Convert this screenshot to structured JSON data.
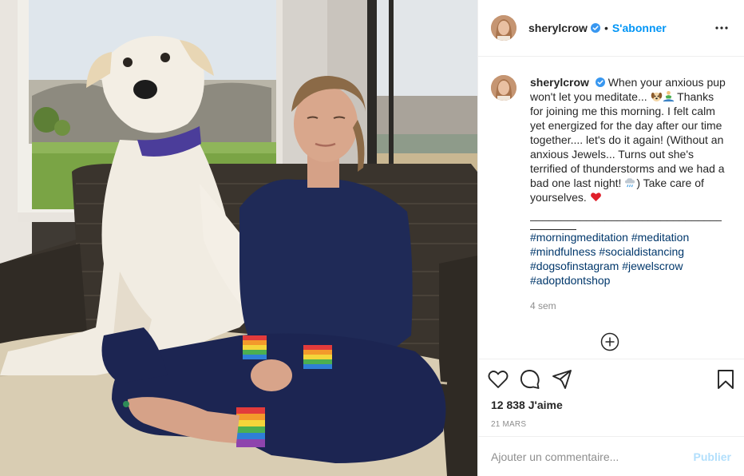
{
  "post": {
    "username": "sherylcrow",
    "follow_label": "S'abonner",
    "dot": "•",
    "verified": true,
    "more_icon": "more-horizontal-icon"
  },
  "caption": {
    "username": "sherylcrow",
    "text_1": "When your anxious pup won't let you meditate... ",
    "text_2": " Thanks for joining me this morning. I felt calm yet energized for the day after our time together.... let's do it again! (Without an anxious Jewels... Turns out she's terrified of thunderstorms and we had a bad one last night! ",
    "text_3": ") Take care of yourselves. ",
    "separator": "_____________________________________________",
    "hashtags": [
      "#morningmeditation",
      "#meditation",
      "#mindfulness",
      "#socialdistancing",
      "#dogsofinstagram",
      "#jewelscrow",
      "#adoptdontshop"
    ],
    "emojis": [
      "dog-face-emoji",
      "person-meditating-emoji",
      "rain-cloud-emoji",
      "red-heart-emoji"
    ],
    "time_ago": "4 sem"
  },
  "actions": {
    "icons": [
      "heart-icon",
      "comment-icon",
      "share-icon",
      "bookmark-icon"
    ],
    "likes": "12 838 J'aime",
    "date": "21 mars"
  },
  "comment_box": {
    "placeholder": "Ajouter un commentaire...",
    "publish_label": "Publier"
  },
  "colors": {
    "link_blue": "#0095f6",
    "hashtag": "#00376b",
    "muted": "#8e8e8e",
    "publish_disabled": "#b2dffc",
    "heart": "#ed4956"
  }
}
